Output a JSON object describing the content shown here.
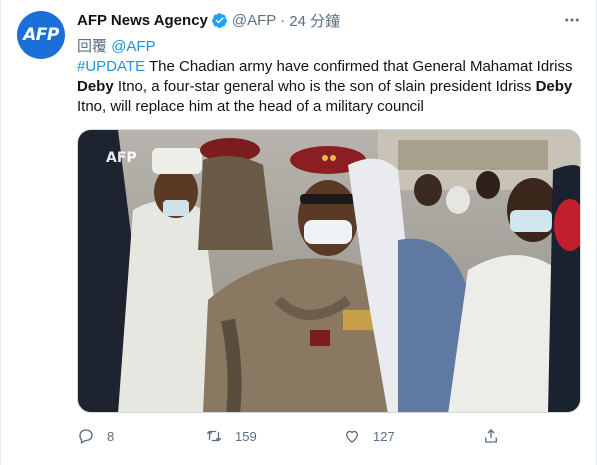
{
  "avatar": {
    "label": "AFP"
  },
  "header": {
    "display_name": "AFP News Agency",
    "handle": "@AFP",
    "separator": "·",
    "time": "24 分鐘"
  },
  "reply": {
    "prefix": "回覆",
    "handle": "@AFP"
  },
  "tweet": {
    "hashtag": "#UPDATE",
    "seg1": " The Chadian army have confirmed that General Mahamat Idriss ",
    "bold1": "Deby",
    "seg2": " Itno, a four-star general who is the son of slain president Idriss ",
    "bold2": "Deby",
    "seg3": " Itno, will replace him at the head of a military council"
  },
  "media": {
    "watermark": "AFP"
  },
  "actions": {
    "reply_count": "8",
    "retweet_count": "159",
    "like_count": "127"
  },
  "colors": {
    "accent": "#1b95e0",
    "muted": "#5b7083",
    "brand": "#1a6fd8"
  }
}
